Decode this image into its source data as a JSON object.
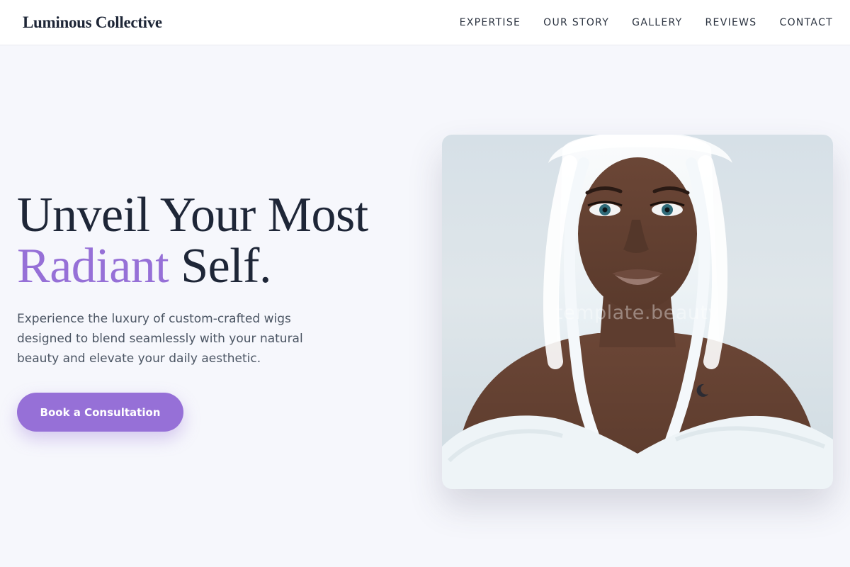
{
  "brand": {
    "name": "Luminous Collective"
  },
  "nav": {
    "links": [
      "EXPERTISE",
      "OUR STORY",
      "GALLERY",
      "REVIEWS",
      "CONTACT"
    ]
  },
  "hero": {
    "headline_line1": "Unveil Your Most",
    "headline_accent": "Radiant",
    "headline_rest": " Self.",
    "description": "Experience the luxury of custom-crafted wigs designed to blend seamlessly with your natural beauty and elevate your daily aesthetic.",
    "cta_label": "Book a Consultation",
    "watermark": "template.beauty"
  },
  "colors": {
    "accent": "#9670d7",
    "heading": "#1e2637",
    "background": "#f6f7fc"
  }
}
